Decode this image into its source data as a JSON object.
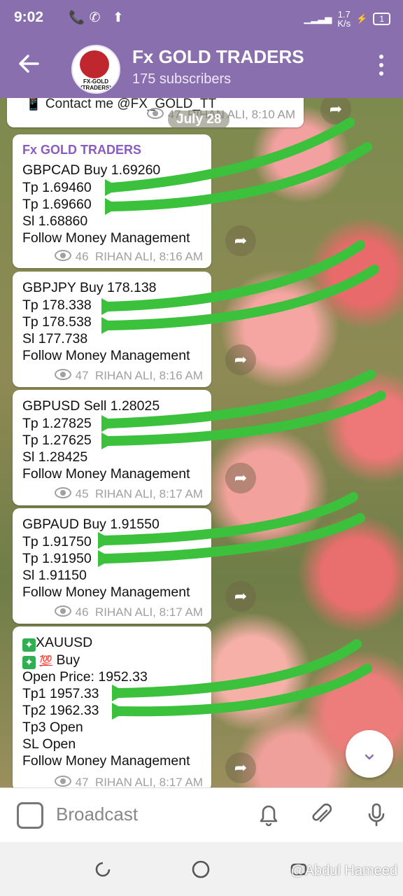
{
  "status": {
    "time": "9:02",
    "left_icons": "📞✆ ⬆",
    "speed_top": "1.7",
    "speed_bottom": "K/s",
    "battery": "1"
  },
  "header": {
    "title": "Fx GOLD TRADERS",
    "subtitle": "175 subscribers",
    "avatar_text": "FX-GOLD (TRADERS)"
  },
  "chat": {
    "previous": {
      "text": "📱 Contact me @FX_GOLD_TT",
      "views": "47",
      "author_time": "RIHAN ALI, 8:10 AM"
    },
    "date_divider": "July 28",
    "messages": [
      {
        "author": "Fx GOLD TRADERS",
        "lines": [
          "GBPCAD Buy 1.69260",
          "Tp  1.69460",
          "Tp  1.69660",
          "Sl  1.68860",
          "Follow Money Management"
        ],
        "views": "46",
        "author_time": "RIHAN ALI, 8:16 AM"
      },
      {
        "lines": [
          "GBPJPY Buy 178.138",
          "Tp  178.338",
          "Tp  178.538",
          "Sl  177.738",
          "Follow Money Management"
        ],
        "views": "47",
        "author_time": "RIHAN ALI, 8:16 AM"
      },
      {
        "lines": [
          "GBPUSD Sell 1.28025",
          "Tp  1.27825",
          "Tp  1.27625",
          "Sl  1.28425",
          "Follow Money Management"
        ],
        "views": "45",
        "author_time": "RIHAN ALI, 8:17 AM"
      },
      {
        "lines": [
          "GBPAUD Buy 1.91550",
          "Tp  1.91750",
          "Tp  1.91950",
          "Sl  1.91150",
          "Follow Money Management"
        ],
        "views": "46",
        "author_time": "RIHAN ALI, 8:17 AM"
      },
      {
        "line1": "XAUUSD",
        "line2_emoji": "💯",
        "line2": " Buy",
        "lines": [
          "Open Price: 1952.33",
          "Tp1   1957.33",
          "Tp2   1962.33",
          "Tp3   Open",
          "SL     Open",
          "Follow Money Management"
        ],
        "views": "47",
        "author_time": "RIHAN ALI, 8:17 AM"
      }
    ]
  },
  "composer": {
    "placeholder": "Broadcast"
  },
  "watermark": "@Abdul Hameed",
  "colors": {
    "header": "#8a6fae",
    "author": "#8a5cc0",
    "arrow": "#3cc13c"
  }
}
